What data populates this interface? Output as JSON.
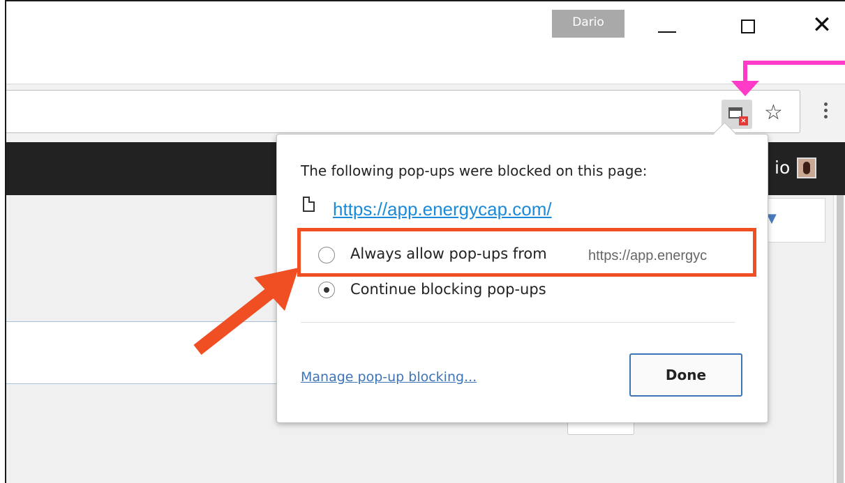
{
  "window": {
    "profile_name": "Dario",
    "minimize_icon": "minimize-icon",
    "maximize_icon": "maximize-icon",
    "close_icon": "close-icon"
  },
  "page": {
    "user_name_fragment": "io"
  },
  "popup_bubble": {
    "title": "The following pop-ups were blocked on this page:",
    "blocked_url": "https://app.energycap.com/",
    "option_allow_label": "Always allow pop-ups from",
    "option_allow_origin": "https://app.energyc",
    "option_block_label": "Continue blocking pop-ups",
    "selected_option": "block",
    "manage_link": "Manage pop-up blocking...",
    "done_button": "Done"
  },
  "annotations": {
    "box_color": "#f04e23",
    "arrow_color": "#f04e23",
    "pointer_color": "#ff3cc7"
  }
}
